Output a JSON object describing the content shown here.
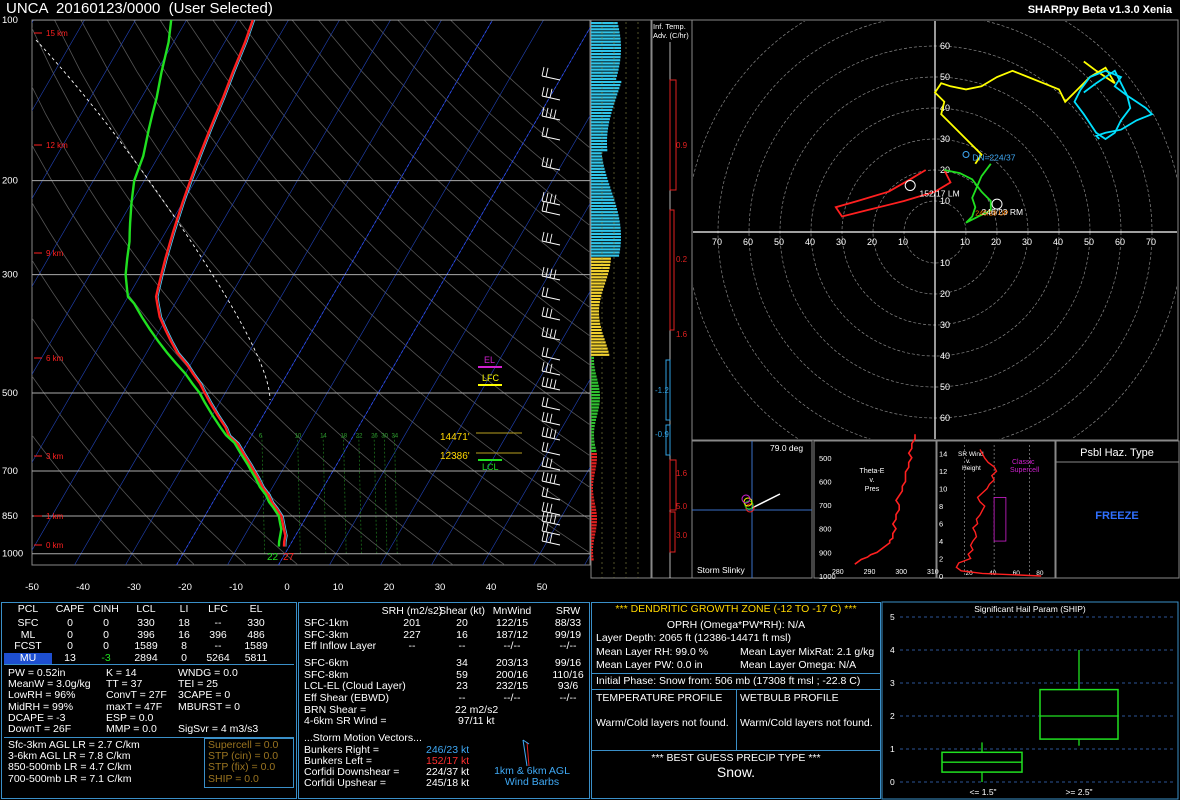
{
  "header": {
    "title": "UNCA  20160123/0000  (User Selected)",
    "version": "SHARPpy Beta v1.3.0 Xenia"
  },
  "skewt": {
    "pressure_labels": [
      "100",
      "200",
      "300",
      "500",
      "700",
      "850",
      "1000"
    ],
    "height_labels": [
      "15 km",
      "12 km",
      "9 km",
      "6 km",
      "3 km",
      "1 km",
      "0 km"
    ],
    "temp_labels": [
      "-50",
      "-40",
      "-30",
      "-20",
      "-10",
      "0",
      "10",
      "20",
      "30",
      "40",
      "50"
    ],
    "mixing_labels": [
      "6",
      "10",
      "14",
      "18",
      "22",
      "26",
      "30",
      "34"
    ],
    "sfc_t": "27",
    "sfc_td": "22",
    "el": "EL",
    "lfc": "LFC",
    "lcl": "LCL",
    "dgz_top": "14471'",
    "dgz_bot": "12386'"
  },
  "chart_data": [
    {
      "type": "line",
      "title": "",
      "xlabel": "",
      "ylabel": "",
      "xlim": [
        -50,
        50
      ],
      "ylim": [
        1000,
        100
      ],
      "yscale": "log",
      "series": [
        {
          "name": "Temperature",
          "color": "#ff2020",
          "p": [
            970,
            950,
            925,
            900,
            875,
            850,
            820,
            800,
            775,
            750,
            720,
            700,
            680,
            650,
            620,
            600,
            580,
            550,
            520,
            500,
            480,
            460,
            440,
            420,
            400,
            380,
            360,
            340,
            330,
            320,
            300,
            280,
            260,
            250,
            240,
            220,
            200,
            180,
            160,
            150,
            140,
            125,
            110,
            100
          ],
          "t": [
            -1,
            -1.5,
            -2,
            -3,
            -4,
            -5,
            -7,
            -8.5,
            -10,
            -12,
            -14,
            -15.5,
            -17,
            -19.5,
            -22,
            -24.5,
            -26,
            -29,
            -32,
            -34,
            -36,
            -38.5,
            -41,
            -44,
            -46.5,
            -49,
            -51.5,
            -53.5,
            -54.5,
            -55,
            -56,
            -57,
            -58,
            -58.5,
            -59,
            -60,
            -61,
            -62,
            -63,
            -63.5,
            -64,
            -65,
            -66,
            -67
          ]
        },
        {
          "name": "Dewpoint",
          "color": "#20e020",
          "p": [
            970,
            950,
            925,
            900,
            875,
            850,
            820,
            800,
            775,
            750,
            720,
            700,
            680,
            650,
            620,
            600,
            580,
            550,
            520,
            500,
            480,
            460,
            440,
            420,
            400,
            380,
            360,
            340,
            330,
            320,
            300,
            280,
            260,
            250,
            240,
            220,
            200,
            180,
            160,
            150,
            140,
            125,
            110,
            100
          ],
          "t": [
            -2,
            -2.5,
            -3,
            -3.5,
            -4.5,
            -5.5,
            -7.5,
            -9,
            -10.5,
            -12.5,
            -14.5,
            -16,
            -17.5,
            -20,
            -22.5,
            -25,
            -27,
            -30,
            -33,
            -35,
            -37.5,
            -40,
            -43,
            -46,
            -49,
            -52,
            -55,
            -58,
            -60,
            -61,
            -63,
            -64.5,
            -66,
            -67,
            -68,
            -70,
            -72,
            -73,
            -75,
            -76,
            -77,
            -79,
            -81,
            -83
          ]
        }
      ]
    },
    {
      "type": "scatter",
      "title": "",
      "xlim": [
        -80,
        80
      ],
      "ylim": [
        -70,
        70
      ],
      "series": [
        {
          "name": "",
          "color": "#ff2020",
          "u": [
            -3,
            -8,
            -15,
            -25,
            -32,
            -30,
            -22,
            -10,
            0,
            5,
            3
          ],
          "v": [
            20,
            17,
            13,
            10,
            8,
            5,
            7,
            10,
            13,
            16,
            20
          ]
        },
        {
          "name": "",
          "color": "#20e020",
          "u": [
            3,
            8,
            12,
            15,
            18,
            18,
            14,
            12,
            10,
            12,
            13,
            12,
            15,
            18
          ],
          "v": [
            20,
            19,
            17,
            13,
            10,
            7,
            5,
            4,
            3,
            5,
            8,
            11,
            18,
            22
          ]
        },
        {
          "name": "",
          "color": "#ffff00",
          "u": [
            13,
            15,
            10,
            5,
            2,
            3,
            0,
            2,
            5,
            10,
            15,
            20,
            25,
            30,
            35,
            40,
            42,
            45,
            50,
            55,
            58,
            52,
            48
          ],
          "v": [
            22,
            25,
            30,
            35,
            38,
            42,
            45,
            48,
            47,
            46,
            47,
            50,
            52,
            50,
            48,
            46,
            42,
            45,
            50,
            53,
            48,
            52,
            55
          ]
        },
        {
          "name": "",
          "color": "#00e0ff",
          "u": [
            48,
            52,
            55,
            58,
            60,
            62,
            63,
            60,
            58,
            55,
            52,
            50,
            48,
            45,
            47,
            50,
            55,
            60,
            58,
            62,
            65,
            68,
            70,
            65,
            60,
            55,
            52,
            53
          ],
          "v": [
            45,
            48,
            50,
            52,
            48,
            44,
            40,
            36,
            32,
            30,
            32,
            35,
            38,
            42,
            46,
            50,
            52,
            50,
            47,
            44,
            42,
            40,
            38,
            36,
            33,
            32,
            31,
            30
          ]
        }
      ]
    },
    {
      "type": "line",
      "title": "",
      "xlim": [
        280,
        310
      ],
      "ylim": [
        1000,
        400
      ],
      "series": [
        {
          "name": "",
          "color": "#ff2020",
          "p": [
            950,
            930,
            920,
            910,
            900,
            880,
            860,
            850,
            840,
            820,
            800,
            780,
            760,
            740,
            720,
            700,
            680,
            660,
            640,
            620,
            600,
            580,
            560,
            540,
            520,
            500,
            480,
            460,
            440,
            420,
            400
          ],
          "theta": [
            285,
            287,
            289,
            290,
            292,
            294,
            296,
            296,
            297,
            297,
            298,
            297,
            298,
            298,
            299,
            299,
            298,
            299,
            300,
            300,
            301,
            301,
            301,
            302,
            302,
            303,
            302,
            303,
            303,
            304,
            304
          ]
        }
      ]
    },
    {
      "type": "line",
      "title": "",
      "xlim": [
        0,
        100
      ],
      "ylim": [
        0,
        15
      ],
      "series": [
        {
          "name": "",
          "color": "#ff2020",
          "z": [
            0,
            0.3,
            0.6,
            1,
            1.5,
            2,
            2.5,
            3,
            3.5,
            4,
            4.5,
            5,
            5.5,
            6,
            6.5,
            7,
            7.5,
            8,
            8.5,
            9,
            9.5,
            10,
            10.5,
            11,
            11.5,
            12,
            12.5,
            13,
            13.5,
            14,
            14.5
          ],
          "s": [
            80,
            30,
            12,
            8,
            10,
            20,
            18,
            22,
            20,
            22,
            25,
            24,
            22,
            26,
            25,
            28,
            30,
            32,
            28,
            26,
            30,
            34,
            36,
            40,
            38,
            42,
            40,
            35,
            32,
            30,
            28
          ]
        }
      ]
    },
    {
      "type": "bar",
      "title": "Significant Hail Param (SHIP)",
      "categories": [
        "<= 1.5\"",
        ">= 2.5\""
      ],
      "ylim": [
        0,
        5
      ],
      "boxes": [
        {
          "min": 0,
          "q1": 0.3,
          "median": 0.6,
          "q3": 0.9,
          "max": 1.2
        },
        {
          "min": 1.1,
          "q1": 1.3,
          "median": 2.0,
          "q3": 2.8,
          "max": 4.0
        }
      ]
    }
  ],
  "inf_temp": {
    "title1": "Inf. Temp.",
    "title2": "Adv. (C/hr)",
    "labels": [
      {
        "v": "0.9",
        "y": 148
      },
      {
        "v": "0.2",
        "y": 262
      },
      {
        "v": "1.6",
        "y": 337
      },
      {
        "v": "-1.2",
        "y": 393
      },
      {
        "v": "-0.9",
        "y": 437
      },
      {
        "v": "1.6",
        "y": 476
      },
      {
        "v": "5.0",
        "y": 509
      },
      {
        "v": "3.0",
        "y": 538
      }
    ]
  },
  "hodo": {
    "rings": [
      "10",
      "20",
      "30",
      "40",
      "50",
      "60",
      "70",
      "80"
    ],
    "ylabels_up": [
      "10",
      "20",
      "30",
      "40",
      "50",
      "60"
    ],
    "ylabels_dn": [
      "10",
      "20",
      "30",
      "40",
      "50",
      "60"
    ],
    "xlabels_left": [
      "80",
      "70",
      "60",
      "50",
      "40",
      "30",
      "20",
      "10"
    ],
    "xlabels_right": [
      "10",
      "20",
      "30",
      "40",
      "50",
      "60",
      "70",
      "80"
    ],
    "dn": "DN=224/37",
    "lm": "152/17 LM",
    "rm": "246/23 RM",
    "up": "245/18 UP"
  },
  "slinky": {
    "title": "Storm Slinky",
    "deg": "79.0 deg"
  },
  "thetae": {
    "title": "Theta-E\nv.\nPres",
    "ylabels": [
      "500",
      "600",
      "700",
      "800",
      "900",
      "1000"
    ],
    "xlabels": [
      "280",
      "290",
      "300",
      "310"
    ]
  },
  "srw": {
    "title1": "SR Wind",
    "title2": "v.",
    "title3": "Height",
    "classic": "Classic",
    "supercell": "Supercell",
    "ylabels": [
      "14",
      "12",
      "10",
      "8",
      "6",
      "4",
      "2",
      "0"
    ],
    "xlabels": [
      "20",
      "40",
      "60",
      "80"
    ]
  },
  "haz": {
    "title": "Psbl Haz. Type",
    "value": "FREEZE"
  },
  "ship": {
    "title": "Significant Hail Param (SHIP)",
    "ylabels": [
      "0",
      "1",
      "2",
      "3",
      "4",
      "5"
    ],
    "x1": "<= 1.5\"",
    "x2": ">= 2.5\""
  },
  "parcels": {
    "headers": [
      "PCL",
      "CAPE",
      "CINH",
      "LCL",
      "LI",
      "LFC",
      "EL"
    ],
    "rows": [
      {
        "pcl": "SFC",
        "cape": "0",
        "cinh": "0",
        "lcl": "330",
        "li": "18",
        "lfc": "--",
        "el": "330"
      },
      {
        "pcl": "ML",
        "cape": "0",
        "cinh": "0",
        "lcl": "396",
        "li": "16",
        "lfc": "396",
        "el": "486"
      },
      {
        "pcl": "FCST",
        "cape": "0",
        "cinh": "0",
        "lcl": "1589",
        "li": "8",
        "lfc": "--",
        "el": "1589"
      },
      {
        "pcl": "MU",
        "cape": "13",
        "cinh": "-3",
        "lcl": "2894",
        "li": "0",
        "lfc": "5264",
        "el": "5811"
      }
    ]
  },
  "indices": {
    "col1": [
      "PW = 0.52in",
      "MeanW = 3.0g/kg",
      "LowRH = 96%",
      "MidRH = 99%",
      "DCAPE = -3",
      "DownT = 26F"
    ],
    "col2": [
      "K = 14",
      "TT = 37",
      "ConvT = 27F",
      "maxT = 47F",
      "ESP = 0.0",
      "MMP = 0.0"
    ],
    "col3": [
      "WNDG = 0.0",
      "TEI = 25",
      "3CAPE = 0",
      "MBURST = 0",
      "",
      ""
    ],
    "sigsvr": "SigSvr = 4 m3/s3",
    "lapse": [
      "Sfc-3km AGL LR = 2.7 C/km",
      "3-6km AGL LR = 7.8 C/km",
      "850-500mb LR = 4.7 C/km",
      "700-500mb LR = 7.1 C/km"
    ],
    "comp": [
      "Supercell = 0.0",
      "STP (cin) = 0.0",
      "STP (fix) = 0.0",
      "SHIP = 0.0"
    ]
  },
  "kin": {
    "headers": [
      "SRH (m2/s2)",
      "Shear (kt)",
      "MnWind",
      "SRW"
    ],
    "rows": [
      {
        "n": "SFC-1km",
        "srh": "201",
        "sh": "20",
        "mw": "122/15",
        "srw": "88/33"
      },
      {
        "n": "SFC-3km",
        "srh": "227",
        "sh": "16",
        "mw": "187/12",
        "srw": "99/19"
      },
      {
        "n": "Eff Inflow Layer",
        "srh": "--",
        "sh": "--",
        "mw": "--/--",
        "srw": "--/--"
      },
      {
        "n": "SFC-6km",
        "srh": "",
        "sh": "34",
        "mw": "203/13",
        "srw": "99/16"
      },
      {
        "n": "SFC-8km",
        "srh": "",
        "sh": "59",
        "mw": "200/16",
        "srw": "110/16"
      },
      {
        "n": "LCL-EL (Cloud Layer)",
        "srh": "",
        "sh": "23",
        "mw": "232/15",
        "srw": "93/6"
      },
      {
        "n": "Eff Shear (EBWD)",
        "srh": "",
        "sh": "--",
        "mw": "--/--",
        "srw": "--/--"
      }
    ],
    "brn_label": "BRN Shear =",
    "brn": "22 m2/s2",
    "sr46_label": "4-6km SR Wind =",
    "sr46": "97/11 kt",
    "vec_title": "...Storm Motion Vectors...",
    "vectors": [
      {
        "n": "Bunkers Right =",
        "v": "246/23 kt",
        "c": "#3fa9f5"
      },
      {
        "n": "Bunkers Left =",
        "v": "152/17 kt",
        "c": "#ff3030"
      },
      {
        "n": "Corfidi Downshear =",
        "v": "224/37 kt",
        "c": "#fff"
      },
      {
        "n": "Corfidi Upshear =",
        "v": "245/18 kt",
        "c": "#fff"
      }
    ],
    "barbs1": "1km & 6km AGL",
    "barbs2": "Wind Barbs"
  },
  "dgz": {
    "title": "*** DENDRITIC GROWTH ZONE (-12 TO -17 C) ***",
    "oprh": "OPRH (Omega*PW*RH): N/A",
    "depth": "Layer Depth: 2065 ft (12386-14471 ft msl)",
    "l1": "Mean Layer RH: 99.0 %",
    "r1": "Mean Layer MixRat: 2.1 g/kg",
    "l2": "Mean Layer PW: 0.0 in",
    "r2": "Mean Layer Omega: N/A",
    "phase": "Initial Phase: Snow from: 506 mb (17308 ft msl ; -22.8 C)",
    "tp": "TEMPERATURE PROFILE",
    "wb": "WETBULB PROFILE",
    "tpv": "Warm/Cold layers not found.",
    "wbv": "Warm/Cold layers not found.",
    "bg": "*** BEST GUESS PRECIP TYPE ***",
    "precip": "Snow."
  }
}
